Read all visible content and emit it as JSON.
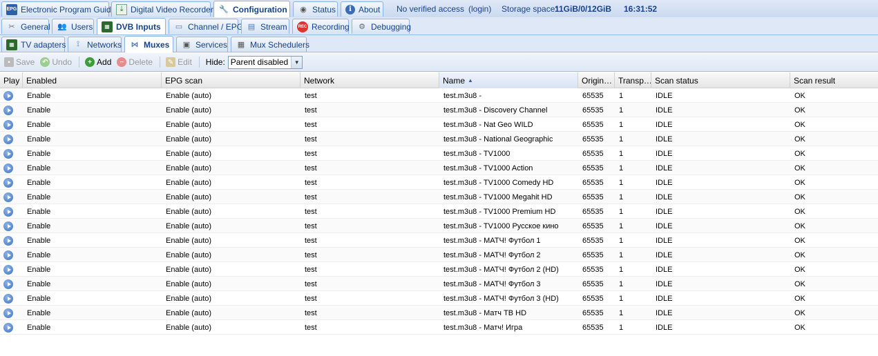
{
  "top_tabs": [
    {
      "label": "Electronic Program Guide",
      "icon": "epg-icon",
      "icon_text": "EPG"
    },
    {
      "label": "Digital Video Recorder",
      "icon": "dvr-icon"
    },
    {
      "label": "Configuration",
      "icon": "wrench-icon",
      "active": true
    },
    {
      "label": "Status",
      "icon": "eye-icon"
    },
    {
      "label": "About",
      "icon": "info-icon"
    }
  ],
  "status": {
    "access": "No verified access",
    "login": "(login)",
    "storage_label": "Storage space:",
    "storage_value": "11GiB/0/12GiB",
    "time": "16:31:52"
  },
  "config_tabs": [
    {
      "label": "General"
    },
    {
      "label": "Users"
    },
    {
      "label": "DVB Inputs",
      "active": true
    },
    {
      "label": "Channel / EPG"
    },
    {
      "label": "Stream"
    },
    {
      "label": "Recording"
    },
    {
      "label": "Debugging"
    }
  ],
  "dvb_tabs": [
    {
      "label": "TV adapters"
    },
    {
      "label": "Networks"
    },
    {
      "label": "Muxes",
      "active": true
    },
    {
      "label": "Services"
    },
    {
      "label": "Mux Schedulers"
    }
  ],
  "toolbar": {
    "save": "Save",
    "undo": "Undo",
    "add": "Add",
    "delete": "Delete",
    "edit": "Edit",
    "hide_label": "Hide:",
    "hide_value": "Parent disabled"
  },
  "columns": [
    "Play",
    "Enabled",
    "EPG scan",
    "Network",
    "Name",
    "Origin…",
    "Transp…",
    "Scan status",
    "Scan result"
  ],
  "rows": [
    {
      "enabled": "Enable",
      "epg": "Enable (auto)",
      "network": "test",
      "name": "test.m3u8 -",
      "origin": "65535",
      "transp": "1",
      "status": "IDLE",
      "result": "OK"
    },
    {
      "enabled": "Enable",
      "epg": "Enable (auto)",
      "network": "test",
      "name": "test.m3u8 - Discovery Channel",
      "origin": "65535",
      "transp": "1",
      "status": "IDLE",
      "result": "OK"
    },
    {
      "enabled": "Enable",
      "epg": "Enable (auto)",
      "network": "test",
      "name": "test.m3u8 - Nat Geo WILD",
      "origin": "65535",
      "transp": "1",
      "status": "IDLE",
      "result": "OK"
    },
    {
      "enabled": "Enable",
      "epg": "Enable (auto)",
      "network": "test",
      "name": "test.m3u8 - National Geographic",
      "origin": "65535",
      "transp": "1",
      "status": "IDLE",
      "result": "OK"
    },
    {
      "enabled": "Enable",
      "epg": "Enable (auto)",
      "network": "test",
      "name": "test.m3u8 - TV1000",
      "origin": "65535",
      "transp": "1",
      "status": "IDLE",
      "result": "OK"
    },
    {
      "enabled": "Enable",
      "epg": "Enable (auto)",
      "network": "test",
      "name": "test.m3u8 - TV1000 Action",
      "origin": "65535",
      "transp": "1",
      "status": "IDLE",
      "result": "OK"
    },
    {
      "enabled": "Enable",
      "epg": "Enable (auto)",
      "network": "test",
      "name": "test.m3u8 - TV1000 Comedy HD",
      "origin": "65535",
      "transp": "1",
      "status": "IDLE",
      "result": "OK"
    },
    {
      "enabled": "Enable",
      "epg": "Enable (auto)",
      "network": "test",
      "name": "test.m3u8 - TV1000 Megahit HD",
      "origin": "65535",
      "transp": "1",
      "status": "IDLE",
      "result": "OK"
    },
    {
      "enabled": "Enable",
      "epg": "Enable (auto)",
      "network": "test",
      "name": "test.m3u8 - TV1000 Premium HD",
      "origin": "65535",
      "transp": "1",
      "status": "IDLE",
      "result": "OK"
    },
    {
      "enabled": "Enable",
      "epg": "Enable (auto)",
      "network": "test",
      "name": "test.m3u8 - TV1000 Русское кино",
      "origin": "65535",
      "transp": "1",
      "status": "IDLE",
      "result": "OK"
    },
    {
      "enabled": "Enable",
      "epg": "Enable (auto)",
      "network": "test",
      "name": "test.m3u8 - МАТЧ! Футбол 1",
      "origin": "65535",
      "transp": "1",
      "status": "IDLE",
      "result": "OK"
    },
    {
      "enabled": "Enable",
      "epg": "Enable (auto)",
      "network": "test",
      "name": "test.m3u8 - МАТЧ! Футбол 2",
      "origin": "65535",
      "transp": "1",
      "status": "IDLE",
      "result": "OK"
    },
    {
      "enabled": "Enable",
      "epg": "Enable (auto)",
      "network": "test",
      "name": "test.m3u8 - МАТЧ! Футбол 2 (HD)",
      "origin": "65535",
      "transp": "1",
      "status": "IDLE",
      "result": "OK"
    },
    {
      "enabled": "Enable",
      "epg": "Enable (auto)",
      "network": "test",
      "name": "test.m3u8 - МАТЧ! Футбол 3",
      "origin": "65535",
      "transp": "1",
      "status": "IDLE",
      "result": "OK"
    },
    {
      "enabled": "Enable",
      "epg": "Enable (auto)",
      "network": "test",
      "name": "test.m3u8 - МАТЧ! Футбол 3 (HD)",
      "origin": "65535",
      "transp": "1",
      "status": "IDLE",
      "result": "OK"
    },
    {
      "enabled": "Enable",
      "epg": "Enable (auto)",
      "network": "test",
      "name": "test.m3u8 - Матч ТВ HD",
      "origin": "65535",
      "transp": "1",
      "status": "IDLE",
      "result": "OK"
    },
    {
      "enabled": "Enable",
      "epg": "Enable (auto)",
      "network": "test",
      "name": "test.m3u8 - Матч! Игра",
      "origin": "65535",
      "transp": "1",
      "status": "IDLE",
      "result": "OK"
    }
  ]
}
